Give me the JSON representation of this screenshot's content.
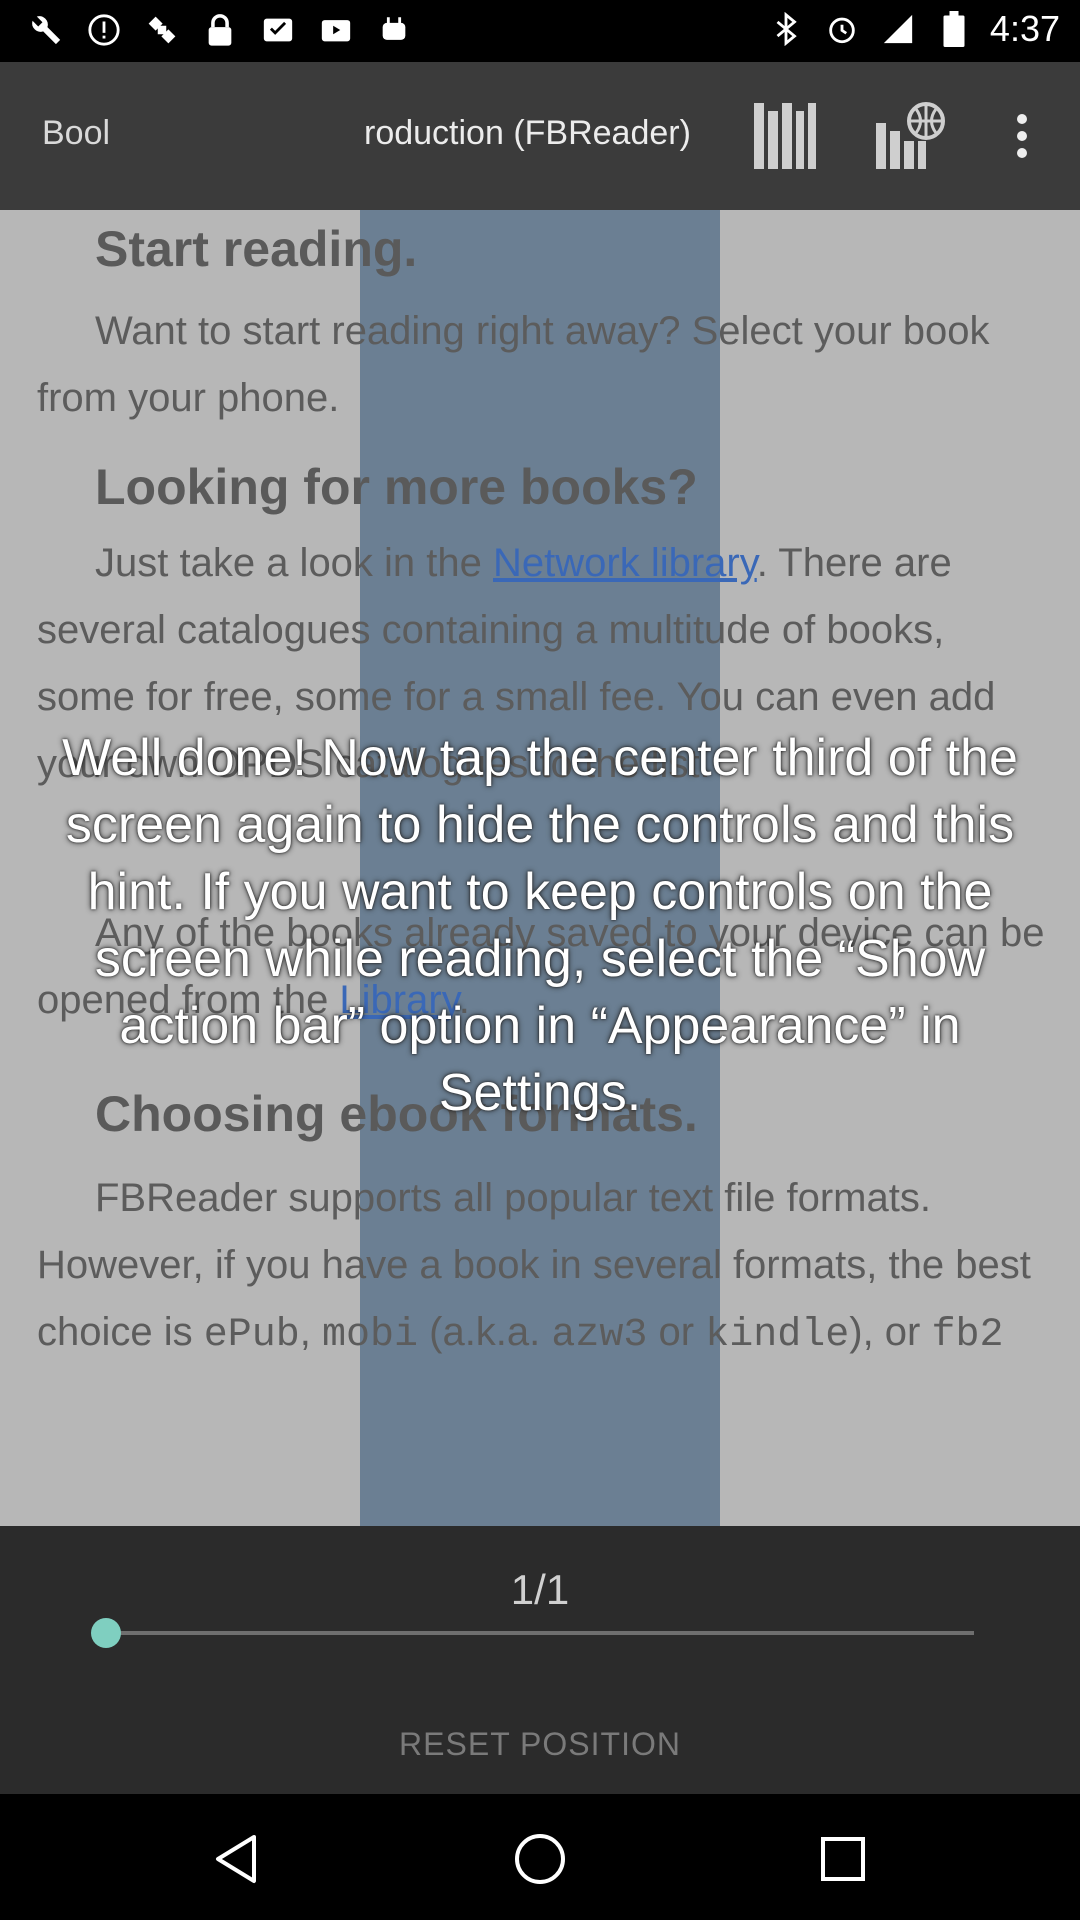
{
  "status_bar": {
    "time": "4:37",
    "left_icons": [
      "wrench-icon",
      "signal-icon",
      "satellite-icon",
      "lock-icon",
      "inbox-icon",
      "play-store-icon",
      "android-icon"
    ],
    "right_icons": [
      "bluetooth-icon",
      "alarm-icon",
      "network-icon",
      "battery-icon"
    ]
  },
  "action_bar": {
    "title_left": "Bool",
    "title_main": "roduction (FBReader)",
    "icons": [
      "library-icon",
      "network-library-icon",
      "overflow-menu-icon"
    ]
  },
  "book": {
    "heading1": "Start reading.",
    "para1": "Want to start reading right away? Select your book from your phone.",
    "heading2": "Looking for more books?",
    "para2_before": "Just take a look in the ",
    "para2_link": "Network library",
    "para2_after": ". There are several catalogues containing a multitude of books, some for free, some for a small fee. You can even add your own OPDS catalogues to the list.",
    "para3_before": "Any of the books already saved to your device can be opened from the ",
    "para3_link": "Library",
    "para3_after": ".",
    "heading3": "Choosing ebook formats.",
    "para4_a": "FBReader supports all popular text file formats. However, if you have a book in several formats, the best choice is ",
    "para4_epub": "ePub",
    "para4_b": ", ",
    "para4_mobi": "mobi",
    "para4_c": " (a.k.a. ",
    "para4_azw3": "azw3",
    "para4_d": " or ",
    "para4_kindle": "kindle",
    "para4_e": "), or ",
    "para4_fb2": "fb2"
  },
  "hint": "Well done! Now tap the center third of the screen again to hide the controls and this hint. If you want to keep controls on the screen while reading, select the “Show action bar” option in “Appearance” in Settings.",
  "navigation_panel": {
    "page_indicator": "1/1",
    "progress": 0.0,
    "reset_label": "RESET POSITION"
  },
  "colors": {
    "accent": "#7fcfc0",
    "link": "#3a68b7",
    "center_highlight": "#6b7f93"
  },
  "nav_bar": {
    "icons": [
      "back-icon",
      "home-icon",
      "recents-icon"
    ]
  }
}
